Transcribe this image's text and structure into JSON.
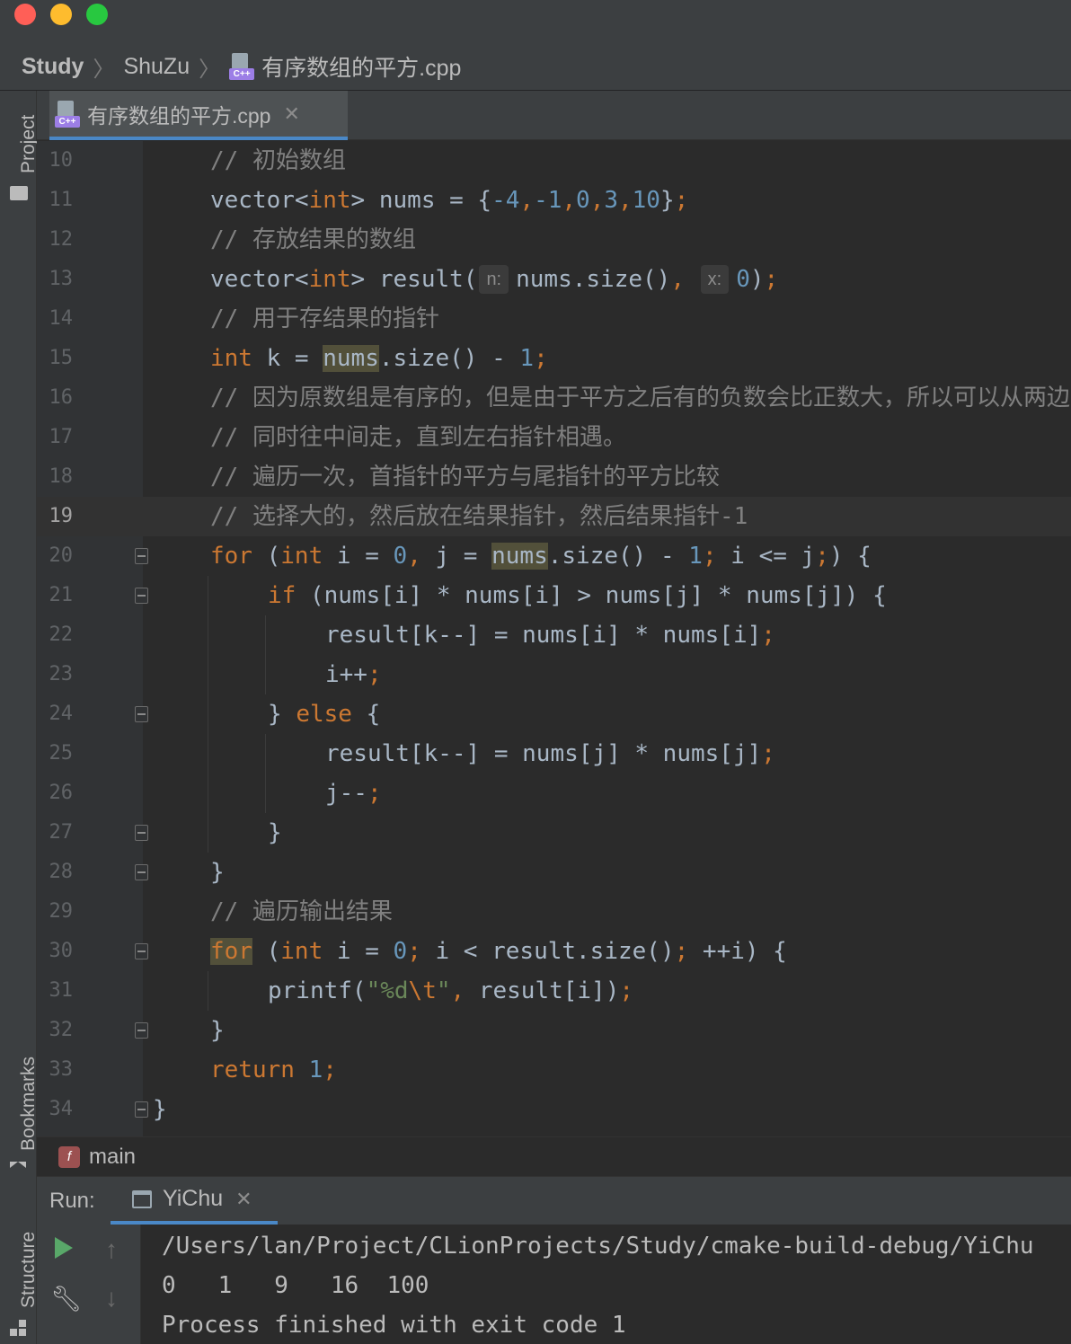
{
  "window": {
    "breadcrumbs": [
      "Study",
      "ShuZu",
      "有序数组的平方.cpp"
    ]
  },
  "toolstrip": {
    "project_label": "Project",
    "bookmarks_label": "Bookmarks",
    "structure_label": "Structure"
  },
  "editor": {
    "tab_label": "有序数组的平方.cpp",
    "current_line": 19,
    "hints": {
      "n": "n:",
      "x": "x:"
    },
    "line_numbers": [
      "10",
      "11",
      "12",
      "13",
      "14",
      "15",
      "16",
      "17",
      "18",
      "19",
      "20",
      "21",
      "22",
      "23",
      "24",
      "25",
      "26",
      "27",
      "28",
      "29",
      "30",
      "31",
      "32",
      "33",
      "34"
    ],
    "lines": {
      "l10": "// 初始数组",
      "l11": "vector<int> nums = {-4,-1,0,3,10};",
      "l12": "// 存放结果的数组",
      "l13": "vector<int> result(nums.size(), 0);",
      "l14": "// 用于存结果的指针",
      "l15": "int k = nums.size() - 1;",
      "l16": "// 因为原数组是有序的，但是由于平方之后有的负数会比正数大，所以可以从两边",
      "l17": "// 同时往中间走，直到左右指针相遇。",
      "l18": "// 遍历一次，首指针的平方与尾指针的平方比较",
      "l19": "// 选择大的，然后放在结果指针，然后结果指针-1",
      "l20": "for (int i = 0, j = nums.size() - 1; i <= j;) {",
      "l21": "if (nums[i] * nums[i] > nums[j] * nums[j]) {",
      "l22": "result[k--] = nums[i] * nums[i];",
      "l23": "i++;",
      "l24": "} else {",
      "l25": "result[k--] = nums[j] * nums[j];",
      "l26": "j--;",
      "l27": "}",
      "l28": "}",
      "l29": "// 遍历输出结果",
      "l30": "for (int i = 0; i < result.size(); ++i) {",
      "l31": "printf(\"%d\\t\", result[i]);",
      "l32": "}",
      "l33": "return 1;",
      "l34": "}"
    }
  },
  "function_breadcrumb": {
    "icon": "f",
    "name": "main"
  },
  "run": {
    "label": "Run:",
    "config": "YiChu",
    "output": [
      "/Users/lan/Project/CLionProjects/Study/cmake-build-debug/YiChu",
      "0\t1\t9\t16\t100",
      "Process finished with exit code 1"
    ]
  },
  "colors": {
    "keyword": "#cc7832",
    "number": "#6897bb",
    "comment": "#808080",
    "string": "#6a8759",
    "text": "#a9b7c6",
    "run_accent": "#4a88c7",
    "play": "#59a869"
  }
}
